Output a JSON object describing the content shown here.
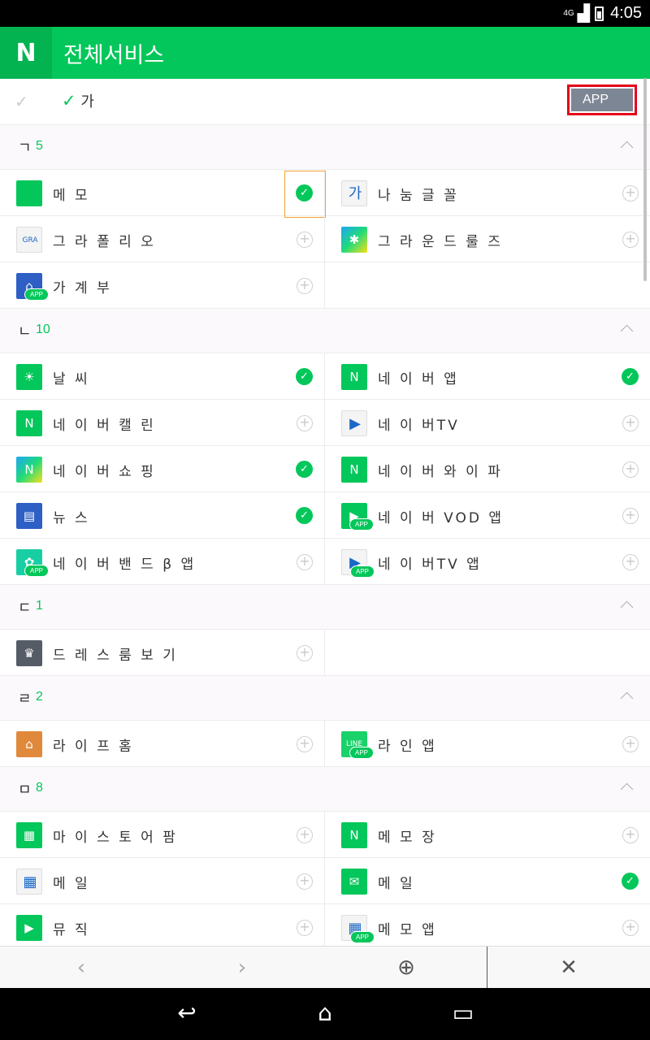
{
  "status": {
    "network": "4G",
    "time": "4:05"
  },
  "header": {
    "logo": "N",
    "title": "전체서비스"
  },
  "subbar": {
    "check": "✓",
    "sort_check": "✓",
    "sort_label": "가",
    "app_button": "APP"
  },
  "sections": [
    {
      "consonant": "ㄱ",
      "count": "5",
      "rows": [
        [
          {
            "name": "메 모",
            "icon": "memo-icon",
            "glyph": "",
            "style": "",
            "state": "checked",
            "focused": true
          },
          {
            "name": "나 눔 글 꼴",
            "icon": "font-icon",
            "glyph": "가",
            "style": "white",
            "state": "add"
          }
        ],
        [
          {
            "name": "그 라 폴 리 오",
            "icon": "grafolio-icon",
            "glyph": "GRA",
            "style": "white",
            "state": "add"
          },
          {
            "name": "그 라 운 드 룰 즈",
            "icon": "ground-icon",
            "glyph": "✱",
            "style": "grad",
            "state": "add"
          }
        ],
        [
          {
            "name": "가 계 부",
            "icon": "household-icon",
            "glyph": "⌂",
            "style": "blue",
            "badge": "APP",
            "state": "add"
          },
          null
        ]
      ]
    },
    {
      "consonant": "ㄴ",
      "count": "10",
      "rows": [
        [
          {
            "name": "날 씨",
            "icon": "weather-icon",
            "glyph": "☀",
            "style": "",
            "state": "checked"
          },
          {
            "name": "네 이 버 앱",
            "icon": "naver-app-icon",
            "glyph": "N",
            "style": "",
            "state": "checked"
          }
        ],
        [
          {
            "name": "네 이 버 캘 린",
            "icon": "calendar-icon",
            "glyph": "N",
            "style": "",
            "state": "add"
          },
          {
            "name": "네 이 버TV",
            "icon": "naver-tv-icon",
            "glyph": "▶",
            "style": "white",
            "state": "add"
          }
        ],
        [
          {
            "name": "네 이 버 쇼 핑",
            "icon": "shopping-icon",
            "glyph": "N",
            "style": "grad",
            "state": "checked"
          },
          {
            "name": "네 이 버 와 이 파",
            "icon": "wifi-icon",
            "glyph": "N",
            "style": "",
            "state": "add"
          }
        ],
        [
          {
            "name": "뉴 스",
            "icon": "news-icon",
            "glyph": "▤",
            "style": "blue",
            "state": "checked"
          },
          {
            "name": "네 이 버 VOD 앱",
            "icon": "vod-icon",
            "glyph": "▶",
            "style": "",
            "badge": "APP",
            "state": "add"
          }
        ],
        [
          {
            "name": "네 이 버 밴 드 β 앱",
            "icon": "band-icon",
            "glyph": "✿",
            "style": "teal",
            "badge": "APP",
            "state": "add"
          },
          {
            "name": "네 이 버TV 앱",
            "icon": "naver-tv-app-icon",
            "glyph": "▶",
            "style": "white",
            "badge": "APP",
            "state": "add"
          }
        ]
      ]
    },
    {
      "consonant": "ㄷ",
      "count": "1",
      "rows": [
        [
          {
            "name": "드 레 스 룸 보 기",
            "icon": "dress-icon",
            "glyph": "♛",
            "style": "gray",
            "state": "add"
          },
          null
        ]
      ]
    },
    {
      "consonant": "ㄹ",
      "count": "2",
      "rows": [
        [
          {
            "name": "라 이 프 홈",
            "icon": "home-icon",
            "glyph": "⌂",
            "style": "orange",
            "state": "add"
          },
          {
            "name": "라 인 앱",
            "icon": "line-icon",
            "glyph": "LINE",
            "style": "lime",
            "badge": "APP",
            "state": "add"
          }
        ]
      ]
    },
    {
      "consonant": "ㅁ",
      "count": "8",
      "rows": [
        [
          {
            "name": "마 이 스 토 어 팜",
            "icon": "store-icon",
            "glyph": "▦",
            "style": "",
            "state": "add"
          },
          {
            "name": "메 모 장",
            "icon": "note-icon",
            "glyph": "N",
            "style": "",
            "state": "add"
          }
        ],
        [
          {
            "name": "메 일",
            "icon": "grid-icon",
            "glyph": "▦",
            "style": "white",
            "state": "add"
          },
          {
            "name": "메 일",
            "icon": "mail-icon",
            "glyph": "✉",
            "style": "",
            "state": "checked"
          }
        ],
        [
          {
            "name": "뮤 직",
            "icon": "music-icon",
            "glyph": "▶",
            "style": "",
            "state": "add"
          },
          {
            "name": "메 모 앱",
            "icon": "memo-app-icon",
            "glyph": "▦",
            "style": "white",
            "badge": "APP",
            "state": "add"
          }
        ]
      ]
    }
  ],
  "toolbar": {
    "back": "‹",
    "forward": "›",
    "globe": "⊕",
    "close": "✕"
  },
  "navbar": {
    "back": "↩",
    "home": "⌂",
    "recent": "▭"
  }
}
